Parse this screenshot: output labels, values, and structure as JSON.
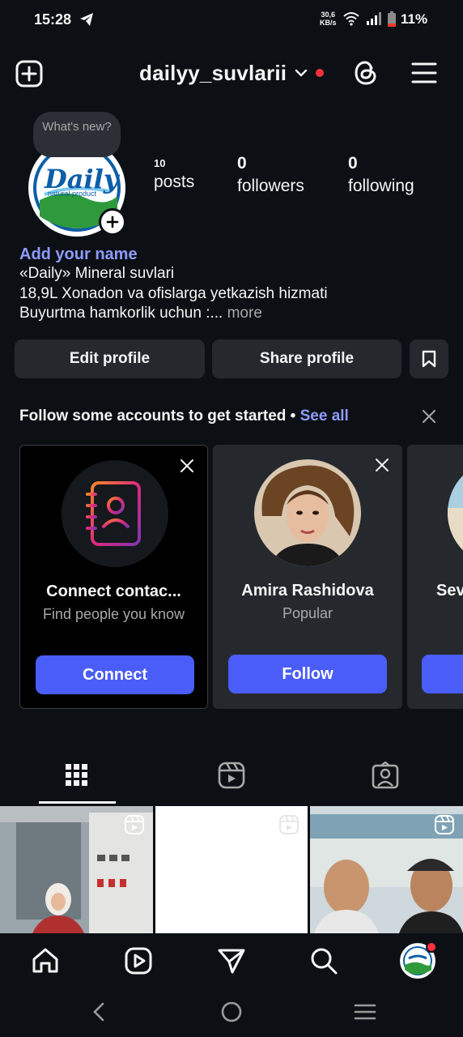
{
  "status_bar": {
    "time": "15:28",
    "net_speed_top": "30,6",
    "net_speed_bottom": "KB/s",
    "battery": "11%"
  },
  "header": {
    "username": "dailyy_suvlarii"
  },
  "profile": {
    "notes_bubble": "What's new?",
    "posts_count": "10",
    "posts_label": "posts",
    "followers_count": "0",
    "followers_label": "followers",
    "following_count": "0",
    "following_label": "following",
    "avatar_text": "Daily",
    "avatar_subtext": "natural product"
  },
  "bio": {
    "add_name": "Add your name",
    "line1": "«Daily» Mineral suvlari",
    "line2": "18,9L Xonadon va ofislarga yetkazish hizmati",
    "line3": "Buyurtma hamkorlik uchun :...",
    "more": " more"
  },
  "buttons": {
    "edit_profile": "Edit profile",
    "share_profile": "Share profile"
  },
  "suggestions": {
    "heading": "Follow some accounts to get started",
    "separator": " • ",
    "see_all": "See all",
    "cards": [
      {
        "name": "Connect contac...",
        "sub": "Find people you know",
        "button": "Connect"
      },
      {
        "name": "Amira Rashidova",
        "sub": "Popular",
        "button": "Follow"
      },
      {
        "name": "Sev",
        "sub": "",
        "button": ""
      }
    ]
  },
  "colors": {
    "background": "#0c1014",
    "accent_link": "#8f9bff",
    "primary_button": "#4a5df9",
    "secondary_button": "#25292e",
    "notification_dot": "#ff3040"
  },
  "icons": {
    "create": "plus-square-icon",
    "threads": "threads-icon",
    "menu": "hamburger-icon",
    "saved": "bookmark-icon",
    "grid_tab": "grid-icon",
    "reels_tab": "reels-icon",
    "tagged_tab": "tagged-person-icon",
    "home": "home-icon",
    "reels": "reels-icon",
    "direct": "send-icon",
    "search": "search-icon"
  }
}
